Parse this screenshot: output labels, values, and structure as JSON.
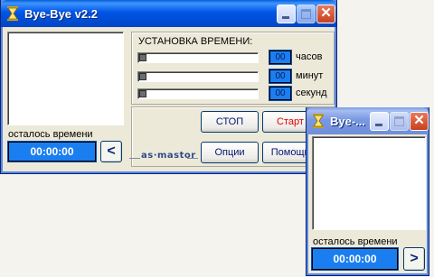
{
  "main_window": {
    "title": "Bye-Bye v2.2",
    "settings_heading": "УСТАНОВКА ВРЕМЕНИ:",
    "rows": [
      {
        "value": "00",
        "unit": "часов"
      },
      {
        "value": "00",
        "unit": "минут"
      },
      {
        "value": "00",
        "unit": "секунд"
      }
    ],
    "remaining_label": "осталось времени",
    "timer": "00:00:00",
    "collapse_arrow": "<",
    "stop_label": "СТОП",
    "start_label": "Старт",
    "options_label": "Опции",
    "help_label": "Помощь",
    "brand": "as·mastor"
  },
  "mini_window": {
    "title": "Bye-...",
    "remaining_label": "осталось времени",
    "timer": "00:00:00",
    "expand_arrow": ">"
  },
  "icons": {
    "app": "hourglass-icon",
    "minimize": "minimize-icon",
    "maximize": "maximize-icon",
    "close": "close-icon"
  },
  "colors": {
    "titlebar_active": "#0055e5",
    "titlebar_inactive": "#7a98e0",
    "time_display": "#1b7ef0",
    "start_text": "#e00000",
    "close_button": "#c8401f"
  }
}
